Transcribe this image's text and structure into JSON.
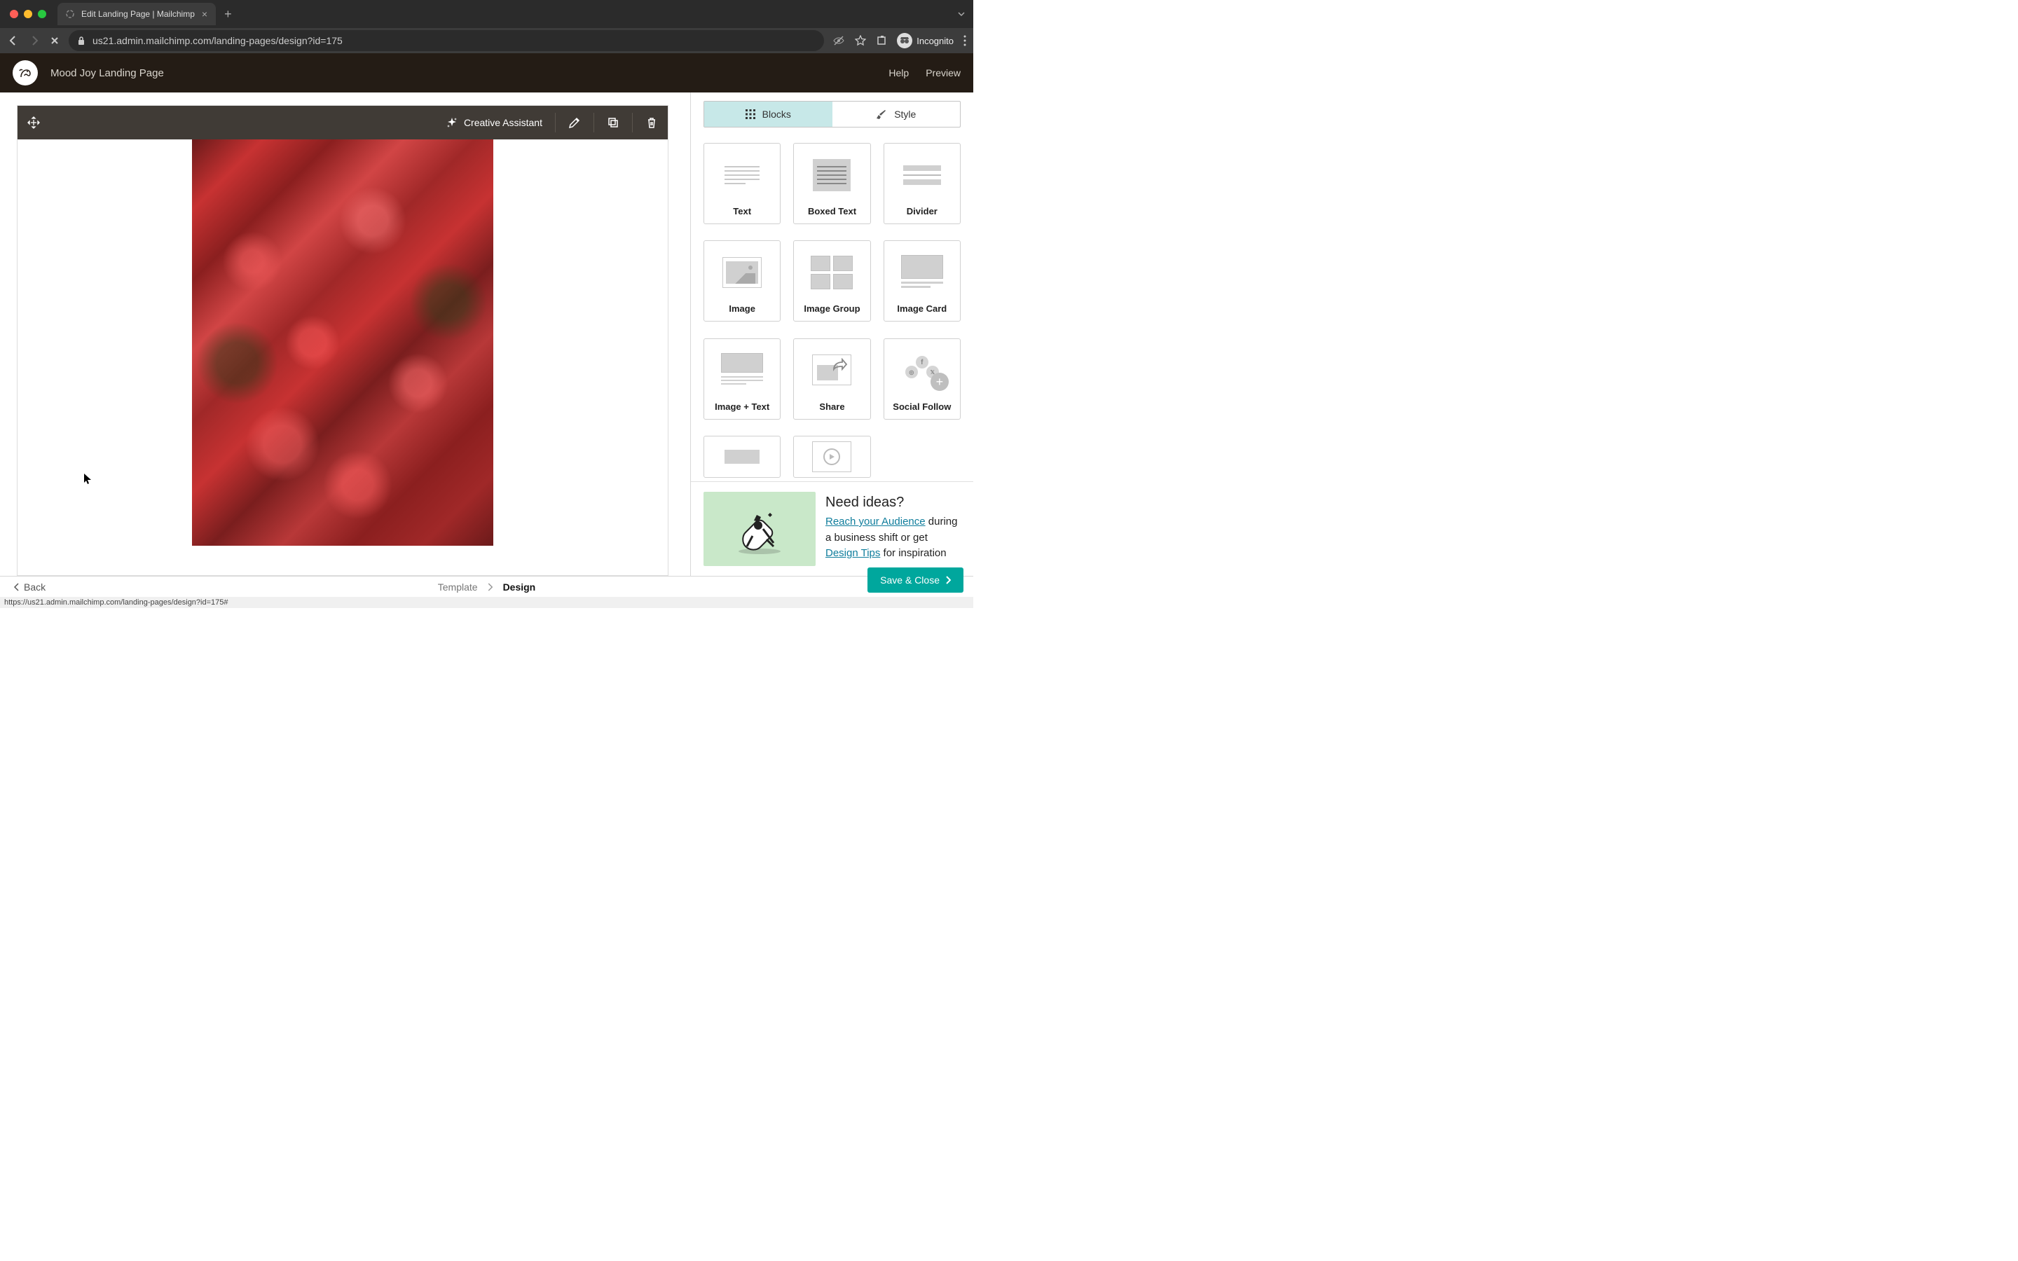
{
  "browser": {
    "tab_title": "Edit Landing Page | Mailchimp",
    "url": "us21.admin.mailchimp.com/landing-pages/design?id=175",
    "incognito_label": "Incognito",
    "status_url": "https://us21.admin.mailchimp.com/landing-pages/design?id=175#"
  },
  "header": {
    "page_title": "Mood Joy Landing Page",
    "help": "Help",
    "preview": "Preview"
  },
  "toolbar": {
    "creative_assistant": "Creative Assistant"
  },
  "sidebar": {
    "tabs": {
      "blocks": "Blocks",
      "style": "Style"
    },
    "blocks": [
      {
        "label": "Text"
      },
      {
        "label": "Boxed Text"
      },
      {
        "label": "Divider"
      },
      {
        "label": "Image"
      },
      {
        "label": "Image Group"
      },
      {
        "label": "Image Card"
      },
      {
        "label": "Image + Text"
      },
      {
        "label": "Share"
      },
      {
        "label": "Social Follow"
      },
      {
        "label": "Button"
      },
      {
        "label": "Video"
      }
    ],
    "ideas": {
      "title": "Need ideas?",
      "link1": "Reach your Audience",
      "text1": " during a business shift or get ",
      "link2": "Design Tips",
      "text2": " for inspiration"
    }
  },
  "footer": {
    "back": "Back",
    "step1": "Template",
    "step2": "Design",
    "save": "Save & Close"
  }
}
